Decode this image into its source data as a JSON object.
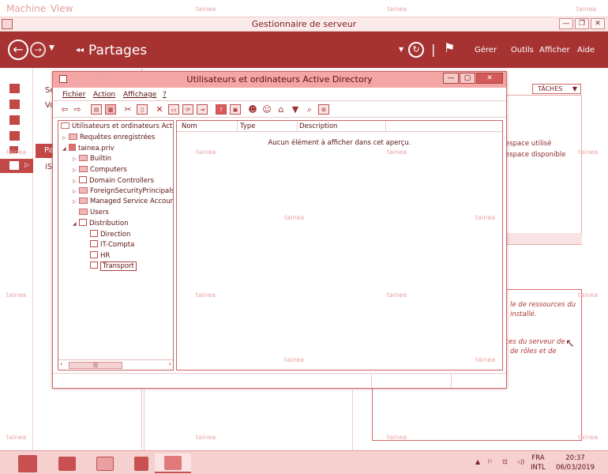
{
  "vm_menu": {
    "machine": "Machine",
    "view": "View"
  },
  "watermark": "tainea",
  "server_manager": {
    "title": "Gestionnaire de serveur",
    "breadcrumb": "Partages",
    "menu": {
      "manage": "Gérer",
      "tools": "Outils",
      "view": "Afficher",
      "help": "Aide"
    },
    "subnav": {
      "item1": "Se",
      "item2": "Vo",
      "item3": "Pa",
      "item4": "iS"
    },
    "tasks_label": "TÂCHES",
    "volume_info": {
      "used": "espace utilisé",
      "free": "espace disponible"
    },
    "role_info": {
      "line1": "le de ressources du",
      "line2": "installé.",
      "line3": "rces du serveur de",
      "line4": "de rôles et de"
    }
  },
  "ad_window": {
    "title": "Utilisateurs et ordinateurs Active Directory",
    "menu": {
      "file": "Fichier",
      "action": "Action",
      "view": "Affichage",
      "help": "?"
    },
    "tree": {
      "root": "Utilisateurs et ordinateurs Active",
      "saved_queries": "Requêtes enregistrées",
      "domain": "tainea.priv",
      "items": [
        "Builtin",
        "Computers",
        "Domain Controllers",
        "ForeignSecurityPrincipals",
        "Managed Service Accour",
        "Users",
        "Distribution"
      ],
      "distribution_children": [
        "Direction",
        "IT-Compta",
        "HR",
        "Transport"
      ],
      "selected": "Transport"
    },
    "columns": {
      "name": "Nom",
      "type": "Type",
      "description": "Description"
    },
    "empty_message": "Aucun élément à afficher dans cet aperçu."
  },
  "taskbar": {
    "lang": "FRA",
    "layout": "INTL",
    "time": "20:37",
    "date": "06/03/2019"
  }
}
